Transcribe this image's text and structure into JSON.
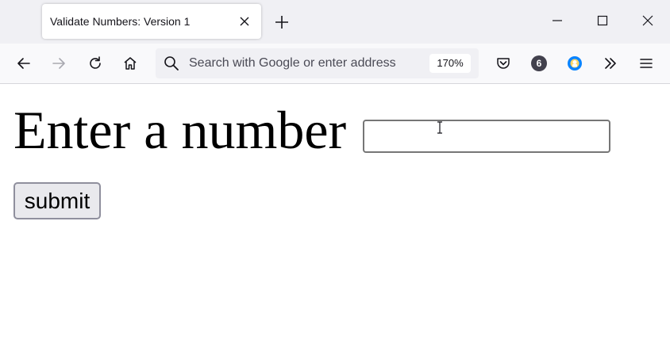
{
  "browser": {
    "tab": {
      "title": "Validate Numbers: Version 1"
    },
    "urlbar": {
      "placeholder": "Search with Google or enter address",
      "zoom": "170%"
    },
    "toolbar": {
      "extension_badge_count": "6"
    }
  },
  "page": {
    "prompt": "Enter a number",
    "input_value": "",
    "submit_label": "submit"
  },
  "colors": {
    "tab_strip": "#f0f0f4",
    "toolbar": "#f9f9fb",
    "urlbar": "#f0f0f4",
    "button_bg": "#e9e9ed",
    "extension_accent": "#0a84ff"
  },
  "icons": [
    "close-icon",
    "plus-icon",
    "minimize-icon",
    "maximize-icon",
    "window-close-icon",
    "back-arrow-icon",
    "forward-arrow-icon",
    "reload-icon",
    "home-icon",
    "search-icon",
    "pocket-icon",
    "extension-icon",
    "chevron-double-right-icon",
    "hamburger-menu-icon",
    "text-cursor-icon"
  ]
}
